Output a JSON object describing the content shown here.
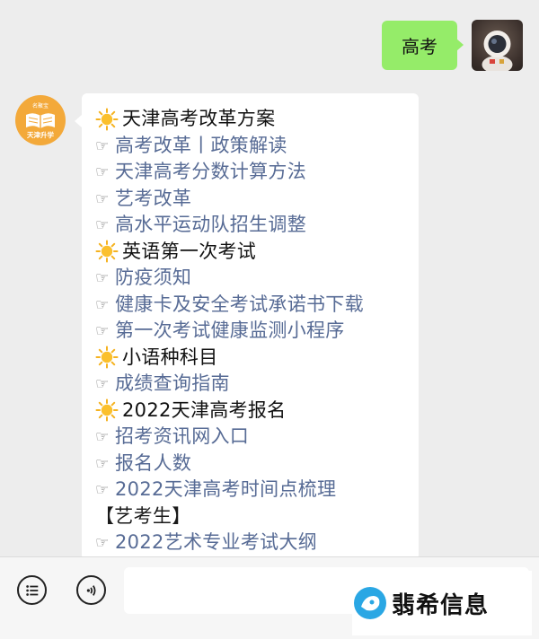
{
  "chat": {
    "outgoing_text": "高考"
  },
  "bot_avatar": {
    "top_text": "名聚宝",
    "main_text": "天津升学"
  },
  "message": {
    "lines": [
      {
        "type": "heading",
        "icon": "sun-icon",
        "text": "天津高考改革方案"
      },
      {
        "type": "link",
        "icon": "pointing-hand-icon",
        "prefix": "☞",
        "text": "高考改革丨政策解读"
      },
      {
        "type": "link",
        "icon": "pointing-hand-icon",
        "prefix": "☞",
        "text": "天津高考分数计算方法"
      },
      {
        "type": "link",
        "icon": "pointing-hand-icon",
        "prefix": "☞",
        "text": "艺考改革"
      },
      {
        "type": "link",
        "icon": "pointing-hand-icon",
        "prefix": "☞",
        "text": "高水平运动队招生调整"
      },
      {
        "type": "heading",
        "icon": "sun-icon",
        "text": "英语第一次考试"
      },
      {
        "type": "link",
        "icon": "pointing-hand-icon",
        "prefix": "☞",
        "text": "防疫须知"
      },
      {
        "type": "link",
        "icon": "pointing-hand-icon",
        "prefix": "☞",
        "text": "健康卡及安全考试承诺书下载"
      },
      {
        "type": "link",
        "icon": "pointing-hand-icon",
        "prefix": "☞",
        "text": "第一次考试健康监测小程序"
      },
      {
        "type": "heading",
        "icon": "sun-icon",
        "text": "小语种科目"
      },
      {
        "type": "link",
        "icon": "pointing-hand-icon",
        "prefix": "☞",
        "text": "成绩查询指南"
      },
      {
        "type": "heading",
        "icon": "sun-icon",
        "text": "2022天津高考报名"
      },
      {
        "type": "link",
        "icon": "pointing-hand-icon",
        "prefix": "☞",
        "text": "招考资讯网入口"
      },
      {
        "type": "link",
        "icon": "pointing-hand-icon",
        "prefix": "☞",
        "text": "报名人数"
      },
      {
        "type": "link",
        "icon": "pointing-hand-icon",
        "prefix": "☞",
        "text": "2022天津高考时间点梳理"
      },
      {
        "type": "plain",
        "icon": "",
        "text": "【艺考生】"
      },
      {
        "type": "link",
        "icon": "pointing-hand-icon",
        "prefix": "☞",
        "text": "2022艺术专业考试大纲"
      }
    ]
  },
  "watermark": {
    "text": "翡希信息"
  },
  "colors": {
    "outgoing_bubble": "#95ec69",
    "link": "#576b95",
    "background": "#ededed"
  }
}
